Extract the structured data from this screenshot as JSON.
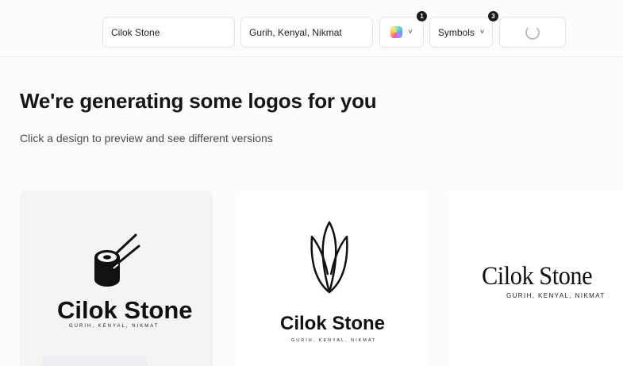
{
  "toolbar": {
    "business_name": "Cilok Stone",
    "slogan": "Gurih, Kenyal, Nikmat",
    "color_badge": "1",
    "symbols_label": "Symbols",
    "symbols_badge": "3",
    "chevron": "˅"
  },
  "heading": {
    "title": "We're generating some logos for you",
    "subtitle": "Click a design to preview and see different versions"
  },
  "cards": [
    {
      "name": "Cilok Stone",
      "tagline": "GURIH, KENYAL, NIKMAT",
      "icon": "skewer-food-icon"
    },
    {
      "name": "Cilok Stone",
      "tagline": "GURIH, KENYAL, NIKMAT",
      "icon": "corn-icon"
    },
    {
      "name": "Cilok Stone",
      "tagline": "GURIH, KENYAL, NIKMAT",
      "icon": ""
    }
  ],
  "colors": {
    "accent_dark": "#1c1c1c",
    "background": "#fcfcfb",
    "card_selected": "#f4f4f3"
  }
}
